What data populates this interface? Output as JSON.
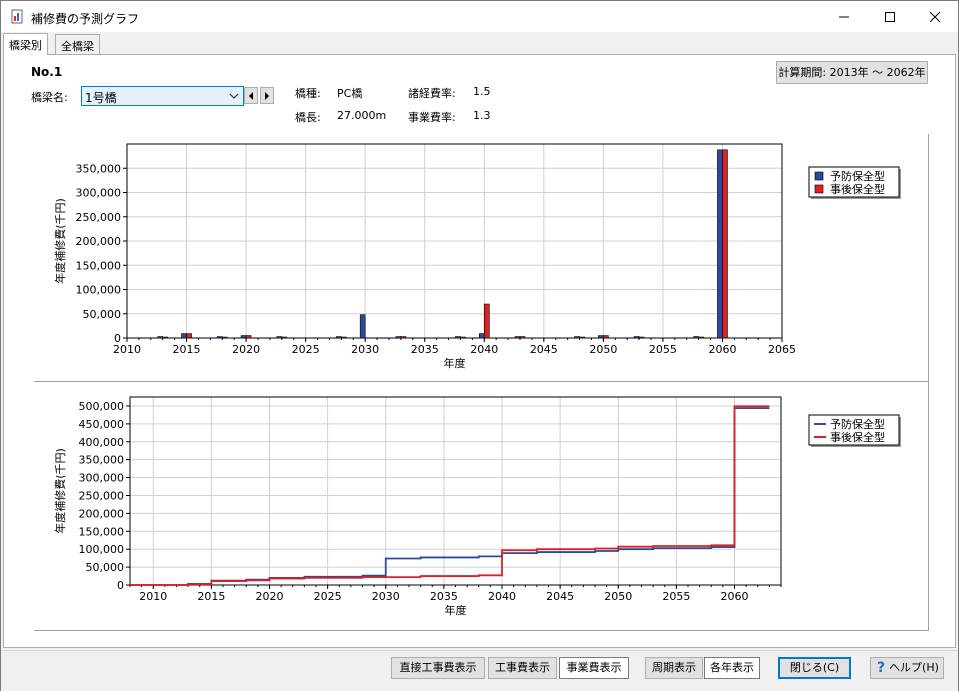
{
  "window": {
    "title": "補修費の予測グラフ"
  },
  "tabs": [
    {
      "label": "橋梁別"
    },
    {
      "label": "全橋梁"
    }
  ],
  "info": {
    "no": "No.1",
    "bridge_name_label": "橋梁名:",
    "bridge_name_value": "1号橋",
    "type_label": "橋種:",
    "type_value": "PC橋",
    "length_label": "橋長:",
    "length_value": "27.000m",
    "misc_rate_label": "諸経費率:",
    "misc_rate_value": "1.5",
    "project_rate_label": "事業費率:",
    "project_rate_value": "1.3"
  },
  "period_button": {
    "label": "計算期間: 2013年 ～ 2062年"
  },
  "colors": {
    "preventive": "#2b4a9b",
    "corrective": "#e02020"
  },
  "chart_data": [
    {
      "type": "bar",
      "ylabel": "年度補修費(千円)",
      "xlabel": "年度",
      "ylim": [
        0,
        400000
      ],
      "yticks": [
        0,
        50000,
        100000,
        150000,
        200000,
        250000,
        300000,
        350000
      ],
      "ytick_labels": [
        "0",
        "50,000",
        "100,000",
        "150,000",
        "200,000",
        "250,000",
        "300,000",
        "350,000"
      ],
      "xlim": [
        2010,
        2065
      ],
      "xticks": [
        2010,
        2015,
        2020,
        2025,
        2030,
        2035,
        2040,
        2045,
        2050,
        2055,
        2060,
        2065
      ],
      "grid": true,
      "legend": "right",
      "series": [
        {
          "name": "予防保全型",
          "x": [
            2013,
            2015,
            2018,
            2020,
            2023,
            2028,
            2030,
            2033,
            2038,
            2040,
            2043,
            2048,
            2050,
            2053,
            2058,
            2060
          ],
          "values": [
            3000,
            9000,
            3000,
            5000,
            3000,
            3000,
            48000,
            3000,
            3000,
            9000,
            3000,
            3000,
            5000,
            3000,
            3000,
            388000
          ]
        },
        {
          "name": "事後保全型",
          "x": [
            2013,
            2015,
            2018,
            2020,
            2023,
            2028,
            2030,
            2033,
            2038,
            2040,
            2043,
            2048,
            2050,
            2053,
            2058,
            2060
          ],
          "values": [
            2000,
            9000,
            2000,
            5000,
            2000,
            2000,
            0,
            3000,
            2000,
            70000,
            3000,
            2000,
            5000,
            2000,
            2000,
            388000
          ]
        }
      ]
    },
    {
      "type": "line",
      "step": true,
      "ylabel": "年度補修費(千円)",
      "xlabel": "年度",
      "ylim": [
        0,
        525000
      ],
      "yticks": [
        0,
        50000,
        100000,
        150000,
        200000,
        250000,
        300000,
        350000,
        400000,
        450000,
        500000
      ],
      "ytick_labels": [
        "0",
        "50,000",
        "100,000",
        "150,000",
        "200,000",
        "250,000",
        "300,000",
        "350,000",
        "400,000",
        "450,000",
        "500,000"
      ],
      "xlim": [
        2008,
        2064
      ],
      "xticks": [
        2010,
        2015,
        2020,
        2025,
        2030,
        2035,
        2040,
        2045,
        2050,
        2055,
        2060
      ],
      "grid": true,
      "legend": "right",
      "series": [
        {
          "name": "予防保全型",
          "x": [
            2008,
            2013,
            2015,
            2018,
            2020,
            2023,
            2028,
            2030,
            2033,
            2038,
            2040,
            2043,
            2048,
            2050,
            2053,
            2058,
            2060,
            2063
          ],
          "values": [
            0,
            3000,
            12000,
            15000,
            20000,
            23000,
            26000,
            74000,
            77000,
            80000,
            89000,
            92000,
            95000,
            100000,
            103000,
            106000,
            494000,
            494000
          ]
        },
        {
          "name": "事後保全型",
          "x": [
            2008,
            2013,
            2015,
            2018,
            2020,
            2023,
            2028,
            2030,
            2033,
            2038,
            2040,
            2043,
            2048,
            2050,
            2053,
            2058,
            2060,
            2063
          ],
          "values": [
            0,
            2000,
            11000,
            13000,
            18000,
            20000,
            22000,
            22000,
            25000,
            27000,
            97000,
            100000,
            102000,
            107000,
            109000,
            111000,
            499000,
            499000
          ]
        }
      ]
    }
  ],
  "buttons": {
    "direct_cost": "直接工事費表示",
    "work_cost": "工事費表示",
    "project_cost": "事業費表示",
    "period_view": "周期表示",
    "yearly_view": "各年表示",
    "close": "閉じる(C)",
    "help": "ヘルプ(H)"
  }
}
